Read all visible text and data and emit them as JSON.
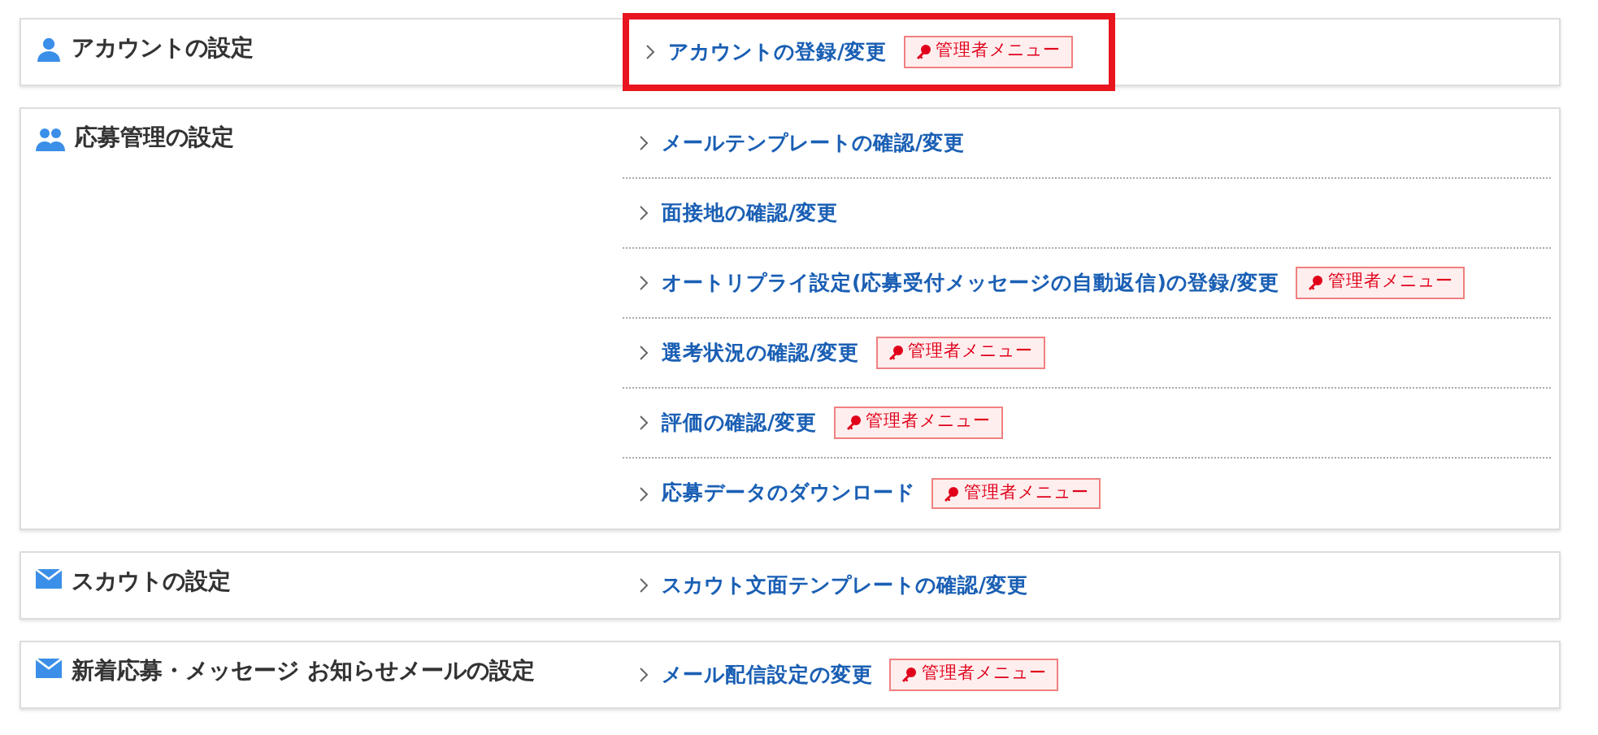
{
  "sections": [
    {
      "kind": "user",
      "title": "アカウントの設定",
      "links": [
        {
          "label": "アカウントの登録/変更",
          "badge": "管理者メニュー",
          "highlighted": true
        }
      ]
    },
    {
      "kind": "users",
      "title": "応募管理の設定",
      "links": [
        {
          "label": "メールテンプレートの確認/変更",
          "highlighted": false
        },
        {
          "label": "面接地の確認/変更",
          "highlighted": false
        },
        {
          "label": "オートリプライ設定(応募受付メッセージの自動返信)の登録/変更",
          "badge": "管理者メニュー",
          "highlighted": false
        },
        {
          "label": "選考状況の確認/変更",
          "badge": "管理者メニュー",
          "highlighted": false
        },
        {
          "label": "評価の確認/変更",
          "badge": "管理者メニュー",
          "highlighted": false
        },
        {
          "label": "応募データのダウンロード",
          "badge": "管理者メニュー",
          "highlighted": false
        }
      ]
    },
    {
      "kind": "mail",
      "title": "スカウトの設定",
      "links": [
        {
          "label": "スカウト文面テンプレートの確認/変更",
          "highlighted": false
        }
      ]
    },
    {
      "kind": "mail",
      "title": "新着応募・メッセージ お知らせメールの設定",
      "links": [
        {
          "label": "メール配信設定の変更",
          "badge": "管理者メニュー",
          "highlighted": false
        }
      ]
    }
  ]
}
